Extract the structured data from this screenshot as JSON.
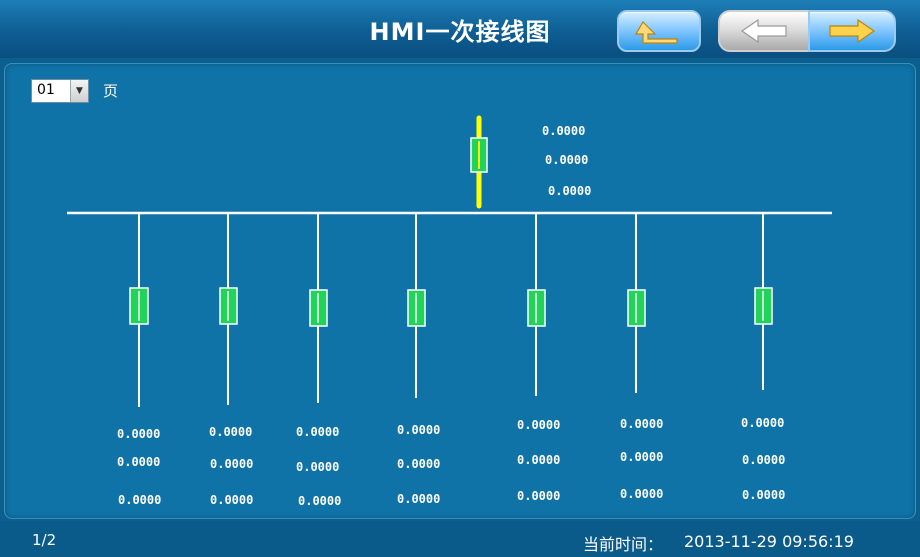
{
  "header": {
    "title": "HMI一次接线图",
    "buttons": [
      {
        "name": "home-up",
        "icon": "up-return-arrow-icon"
      },
      {
        "name": "previous",
        "icon": "left-arrow-icon"
      },
      {
        "name": "next",
        "icon": "right-arrow-icon"
      }
    ]
  },
  "page_select": {
    "value": "01",
    "label": "页"
  },
  "incoming": {
    "values": [
      "0.0000",
      "0.0000",
      "0.0000"
    ]
  },
  "feeders": [
    {
      "values": [
        "0.0000",
        "0.0000",
        "0.0000"
      ]
    },
    {
      "values": [
        "0.0000",
        "0.0000",
        "0.0000"
      ]
    },
    {
      "values": [
        "0.0000",
        "0.0000",
        "0.0000"
      ]
    },
    {
      "values": [
        "0.0000",
        "0.0000",
        "0.0000"
      ]
    },
    {
      "values": [
        "0.0000",
        "0.0000",
        "0.0000"
      ]
    },
    {
      "values": [
        "0.0000",
        "0.0000",
        "0.0000"
      ]
    },
    {
      "values": [
        "0.0000",
        "0.0000",
        "0.0000"
      ]
    }
  ],
  "footer": {
    "page_indicator": "1/2",
    "time_label": "当前时间：",
    "time_value": "2013-11-29 09:56:19"
  },
  "colors": {
    "background": "#0b5f8f",
    "panel": "#0f73a8",
    "breaker_fill": "#22d35a",
    "incoming_line": "#ffff00",
    "bus_line": "#ffffff"
  }
}
